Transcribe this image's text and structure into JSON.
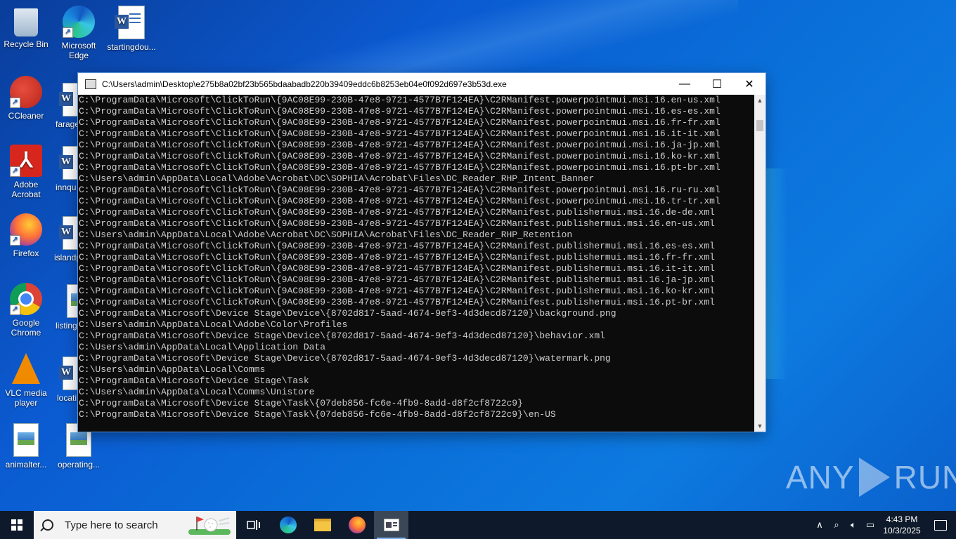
{
  "desktop": {
    "icons": [
      {
        "label": "Recycle Bin"
      },
      {
        "label": "Microsoft Edge"
      },
      {
        "label": "startingdou..."
      },
      {
        "label": "CCleaner"
      },
      {
        "label": "farage"
      },
      {
        "label": "Adobe Acrobat"
      },
      {
        "label": "innqu"
      },
      {
        "label": "Firefox"
      },
      {
        "label": "islandp"
      },
      {
        "label": "Google Chrome"
      },
      {
        "label": "listing"
      },
      {
        "label": "VLC media player"
      },
      {
        "label": "locati"
      },
      {
        "label": "animalter..."
      },
      {
        "label": "operating..."
      }
    ]
  },
  "console_window": {
    "title": "C:\\Users\\admin\\Desktop\\e275b8a02bf23b565bdaabadb220b39409eddc6b8253eb04e0f092d697e3b53d.exe",
    "minimize_label": "—",
    "maximize_label": "☐",
    "close_label": "✕",
    "lines": [
      "C:\\ProgramData\\Microsoft\\ClickToRun\\{9AC08E99-230B-47e8-9721-4577B7F124EA}\\C2RManifest.powerpointmui.msi.16.en-us.xml",
      "C:\\ProgramData\\Microsoft\\ClickToRun\\{9AC08E99-230B-47e8-9721-4577B7F124EA}\\C2RManifest.powerpointmui.msi.16.es-es.xml",
      "C:\\ProgramData\\Microsoft\\ClickToRun\\{9AC08E99-230B-47e8-9721-4577B7F124EA}\\C2RManifest.powerpointmui.msi.16.fr-fr.xml",
      "C:\\ProgramData\\Microsoft\\ClickToRun\\{9AC08E99-230B-47e8-9721-4577B7F124EA}\\C2RManifest.powerpointmui.msi.16.it-it.xml",
      "C:\\ProgramData\\Microsoft\\ClickToRun\\{9AC08E99-230B-47e8-9721-4577B7F124EA}\\C2RManifest.powerpointmui.msi.16.ja-jp.xml",
      "C:\\ProgramData\\Microsoft\\ClickToRun\\{9AC08E99-230B-47e8-9721-4577B7F124EA}\\C2RManifest.powerpointmui.msi.16.ko-kr.xml",
      "C:\\ProgramData\\Microsoft\\ClickToRun\\{9AC08E99-230B-47e8-9721-4577B7F124EA}\\C2RManifest.powerpointmui.msi.16.pt-br.xml",
      "C:\\Users\\admin\\AppData\\Local\\Adobe\\Acrobat\\DC\\SOPHIA\\Acrobat\\Files\\DC_Reader_RHP_Intent_Banner",
      "C:\\ProgramData\\Microsoft\\ClickToRun\\{9AC08E99-230B-47e8-9721-4577B7F124EA}\\C2RManifest.powerpointmui.msi.16.ru-ru.xml",
      "C:\\ProgramData\\Microsoft\\ClickToRun\\{9AC08E99-230B-47e8-9721-4577B7F124EA}\\C2RManifest.powerpointmui.msi.16.tr-tr.xml",
      "C:\\ProgramData\\Microsoft\\ClickToRun\\{9AC08E99-230B-47e8-9721-4577B7F124EA}\\C2RManifest.publishermui.msi.16.de-de.xml",
      "C:\\ProgramData\\Microsoft\\ClickToRun\\{9AC08E99-230B-47e8-9721-4577B7F124EA}\\C2RManifest.publishermui.msi.16.en-us.xml",
      "C:\\Users\\admin\\AppData\\Local\\Adobe\\Acrobat\\DC\\SOPHIA\\Acrobat\\Files\\DC_Reader_RHP_Retention",
      "C:\\ProgramData\\Microsoft\\ClickToRun\\{9AC08E99-230B-47e8-9721-4577B7F124EA}\\C2RManifest.publishermui.msi.16.es-es.xml",
      "C:\\ProgramData\\Microsoft\\ClickToRun\\{9AC08E99-230B-47e8-9721-4577B7F124EA}\\C2RManifest.publishermui.msi.16.fr-fr.xml",
      "C:\\ProgramData\\Microsoft\\ClickToRun\\{9AC08E99-230B-47e8-9721-4577B7F124EA}\\C2RManifest.publishermui.msi.16.it-it.xml",
      "C:\\ProgramData\\Microsoft\\ClickToRun\\{9AC08E99-230B-47e8-9721-4577B7F124EA}\\C2RManifest.publishermui.msi.16.ja-jp.xml",
      "C:\\ProgramData\\Microsoft\\ClickToRun\\{9AC08E99-230B-47e8-9721-4577B7F124EA}\\C2RManifest.publishermui.msi.16.ko-kr.xml",
      "C:\\ProgramData\\Microsoft\\ClickToRun\\{9AC08E99-230B-47e8-9721-4577B7F124EA}\\C2RManifest.publishermui.msi.16.pt-br.xml",
      "C:\\ProgramData\\Microsoft\\Device Stage\\Device\\{8702d817-5aad-4674-9ef3-4d3decd87120}\\background.png",
      "C:\\Users\\admin\\AppData\\Local\\Adobe\\Color\\Profiles",
      "C:\\ProgramData\\Microsoft\\Device Stage\\Device\\{8702d817-5aad-4674-9ef3-4d3decd87120}\\behavior.xml",
      "C:\\Users\\admin\\AppData\\Local\\Application Data",
      "C:\\ProgramData\\Microsoft\\Device Stage\\Device\\{8702d817-5aad-4674-9ef3-4d3decd87120}\\watermark.png",
      "C:\\Users\\admin\\AppData\\Local\\Comms",
      "C:\\ProgramData\\Microsoft\\Device Stage\\Task",
      "C:\\Users\\admin\\AppData\\Local\\Comms\\Unistore",
      "C:\\ProgramData\\Microsoft\\Device Stage\\Task\\{07deb856-fc6e-4fb9-8add-d8f2cf8722c9}",
      "C:\\ProgramData\\Microsoft\\Device Stage\\Task\\{07deb856-fc6e-4fb9-8add-d8f2cf8722c9}\\en-US"
    ]
  },
  "watermark": {
    "left": "ANY",
    "right": "RUN"
  },
  "taskbar": {
    "search_placeholder": "Type here to search",
    "items": [
      "task-view-icon",
      "edge-icon",
      "file-explorer-icon",
      "firefox-icon",
      "console-app-icon"
    ],
    "clock_time": "4:43 PM",
    "clock_date": "10/3/2025"
  },
  "colors": {
    "console_bg": "#0c0c0c",
    "console_text": "#cccccc",
    "taskbar_bg": "#0e1a2b",
    "desktop_blue": "#0b5ad1"
  }
}
